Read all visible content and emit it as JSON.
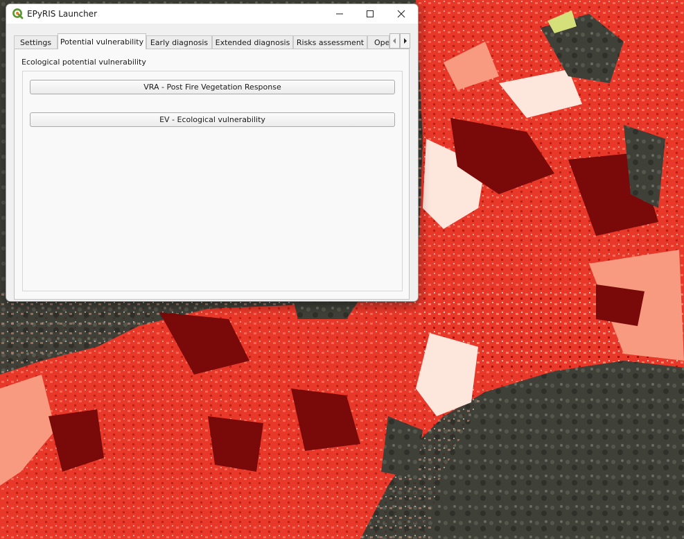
{
  "window": {
    "title": "EPyRIS Launcher",
    "icon": "qgis-icon",
    "controls": {
      "minimize": "minimize-icon",
      "maximize": "maximize-icon",
      "close": "close-icon"
    }
  },
  "tabs": [
    {
      "label": "Settings",
      "active": false
    },
    {
      "label": "Potential vulnerability",
      "active": true
    },
    {
      "label": "Early diagnosis",
      "active": false
    },
    {
      "label": "Extended diagnosis",
      "active": false
    },
    {
      "label": "Risks assessment",
      "active": false
    },
    {
      "label": "Oper",
      "active": false
    }
  ],
  "tab_scroll": {
    "left": "chevron-left-icon",
    "right": "chevron-right-icon"
  },
  "panel": {
    "section_label": "Ecological potential vulnerability",
    "buttons": [
      {
        "label": "VRA - Post Fire Vegetation Response"
      },
      {
        "label": "EV - Ecological vulnerability"
      }
    ]
  },
  "colors": {
    "map_dark_red": "#7a0a0a",
    "map_red": "#e8382a",
    "map_salmon": "#f79a80",
    "map_light": "#fde6dc",
    "map_terrain": "#3f3f38",
    "qgis_green": "#589632"
  }
}
